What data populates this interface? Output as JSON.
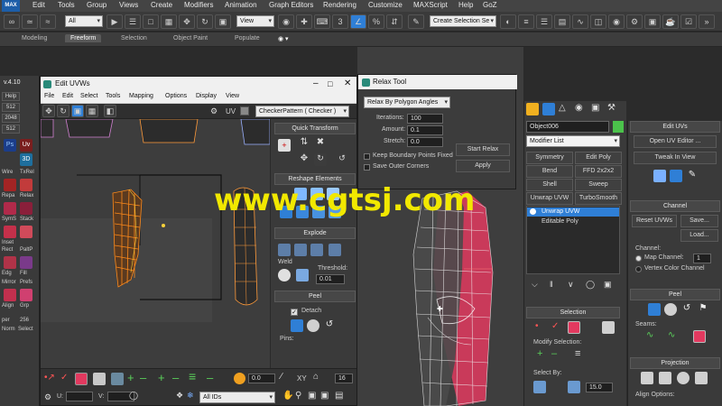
{
  "app": {
    "logo": "MAX"
  },
  "menu": [
    "Edit",
    "Tools",
    "Group",
    "Views",
    "Create",
    "Modifiers",
    "Animation",
    "Graph Editors",
    "Rendering",
    "Customize",
    "MAXScript",
    "Help",
    "GoZ"
  ],
  "toolbar": {
    "filter_select": "All",
    "view_select": "View",
    "selection_set": "Create Selection Se"
  },
  "ribbon": {
    "tabs": [
      "Modeling",
      "Freeform",
      "Selection",
      "Object Paint",
      "Populate"
    ],
    "active": "Freeform"
  },
  "left_strip": {
    "version": "v.4.10",
    "tiles": [
      "Help",
      "512",
      "2048",
      "512",
      "Ps",
      "Uv",
      "3D",
      "Wire",
      "TxRel",
      "Repa",
      "Relax",
      "SymS",
      "Stack",
      "Inset",
      "Rect",
      "PaltP",
      "Edg",
      "Fill",
      "Mirror",
      "Prefs",
      "Align",
      "Grp",
      "per",
      "256",
      "Norm",
      "Select"
    ]
  },
  "uvw": {
    "title": "Edit UVWs",
    "menu": [
      "File",
      "Edit",
      "Select",
      "Tools",
      "Mapping",
      "Options",
      "Display",
      "View"
    ],
    "uv_label": "UV",
    "checker": "CheckerPattern  ( Checker )",
    "sections": {
      "quick_transform": "Quick Transform",
      "reshape": "Reshape Elements",
      "explode": "Explode",
      "weld": "Weld",
      "threshold": "Threshold:",
      "threshold_value": "0.01",
      "peel": "Peel",
      "detach": "Detach",
      "pins": "Pins:"
    },
    "bottom": {
      "value1": "0.0",
      "xy": "XY",
      "value2": "16",
      "u_label": "U:",
      "v_label": "V:",
      "ids": "All IDs"
    }
  },
  "relax": {
    "title": "Relax Tool",
    "method": "Relax By Polygon Angles",
    "iterations_label": "Iterations:",
    "iterations": "100",
    "amount_label": "Amount:",
    "amount": "0.1",
    "stretch_label": "Stretch:",
    "stretch": "0.0",
    "keep_boundary": "Keep Boundary Points Fixed",
    "save_outer": "Save Outer Corners",
    "start_button": "Start Relax",
    "apply_button": "Apply"
  },
  "cmd": {
    "object_name": "Object006",
    "modifier_list": "Modifier List",
    "buttons": [
      "Symmetry",
      "Edit Poly",
      "Bend",
      "FFD 2x2x2",
      "Shell",
      "Sweep",
      "Unwrap UVW",
      "TurboSmooth"
    ],
    "stack": [
      "Unwrap UVW",
      "Editable Poly"
    ],
    "selection": "Selection",
    "modify_selection": "Modify Selection:",
    "select_by": "Select By:",
    "select_value": "15.0"
  },
  "edit_uvs": {
    "title": "Edit UVs",
    "open_editor": "Open UV Editor ...",
    "tweak": "Tweak In View",
    "channel_section": "Channel",
    "reset": "Reset UVWs",
    "save": "Save...",
    "load": "Load...",
    "channel_label": "Channel:",
    "map_channel": "Map Channel:",
    "map_channel_value": "1",
    "vertex_color": "Vertex Color Channel",
    "peel": "Peel",
    "seams": "Seams:",
    "projection": "Projection",
    "align": "Align Options:"
  },
  "watermark": "www.cgtsj.com",
  "colors": {
    "accent": "#2f7fd6",
    "uv_wire": "#ff8a1a",
    "mesh": "#e2395f",
    "watermark": "#f1e800"
  }
}
